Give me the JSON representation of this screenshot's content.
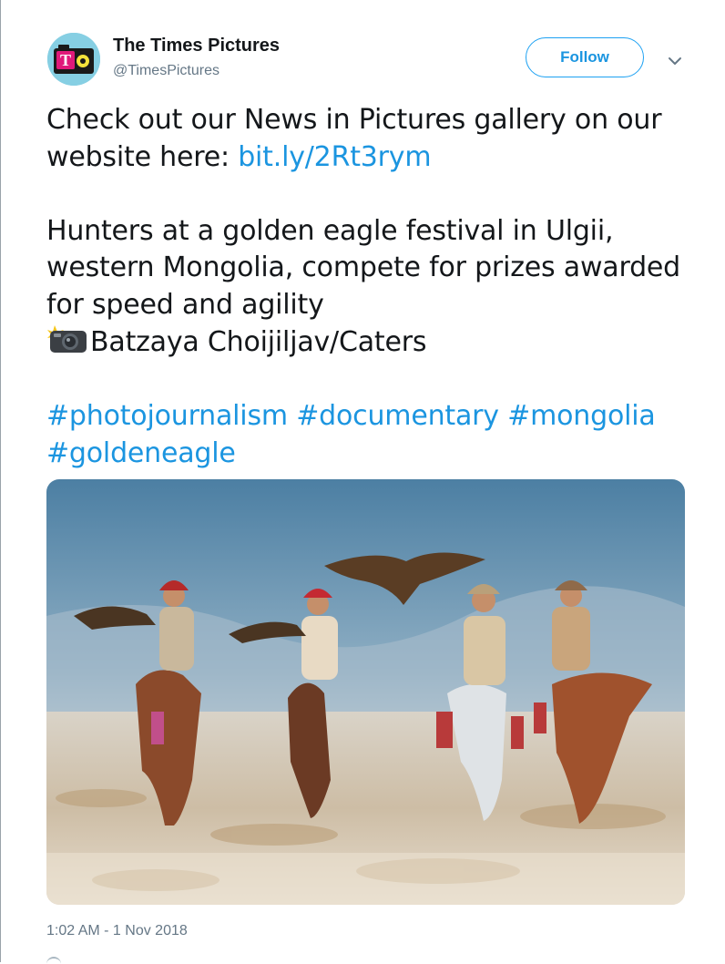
{
  "user": {
    "display_name": "The Times Pictures",
    "handle": "@TimesPictures",
    "avatar_letter": "T"
  },
  "actions": {
    "follow_label": "Follow",
    "menu_icon": "chevron-down-icon"
  },
  "tweet": {
    "line1": "Check out our News in Pictures gallery on our website here: ",
    "link": "bit.ly/2Rt3rym",
    "caption": "Hunters at a golden eagle festival in Ulgii, western Mongolia, compete for prizes awarded for speed and agility",
    "camera_icon": "camera-flash-icon",
    "credit": "Batzaya Choijiljav/Caters",
    "hashtags": [
      "#photojournalism",
      "#documentary",
      "#mongolia",
      "#goldeneagle"
    ],
    "timestamp": "1:02 AM - 1 Nov 2018"
  },
  "colors": {
    "link": "#1b95e0",
    "text": "#14171a",
    "muted": "#657786",
    "avatar_bg": "#86cfe3",
    "avatar_accent": "#e0197a"
  }
}
